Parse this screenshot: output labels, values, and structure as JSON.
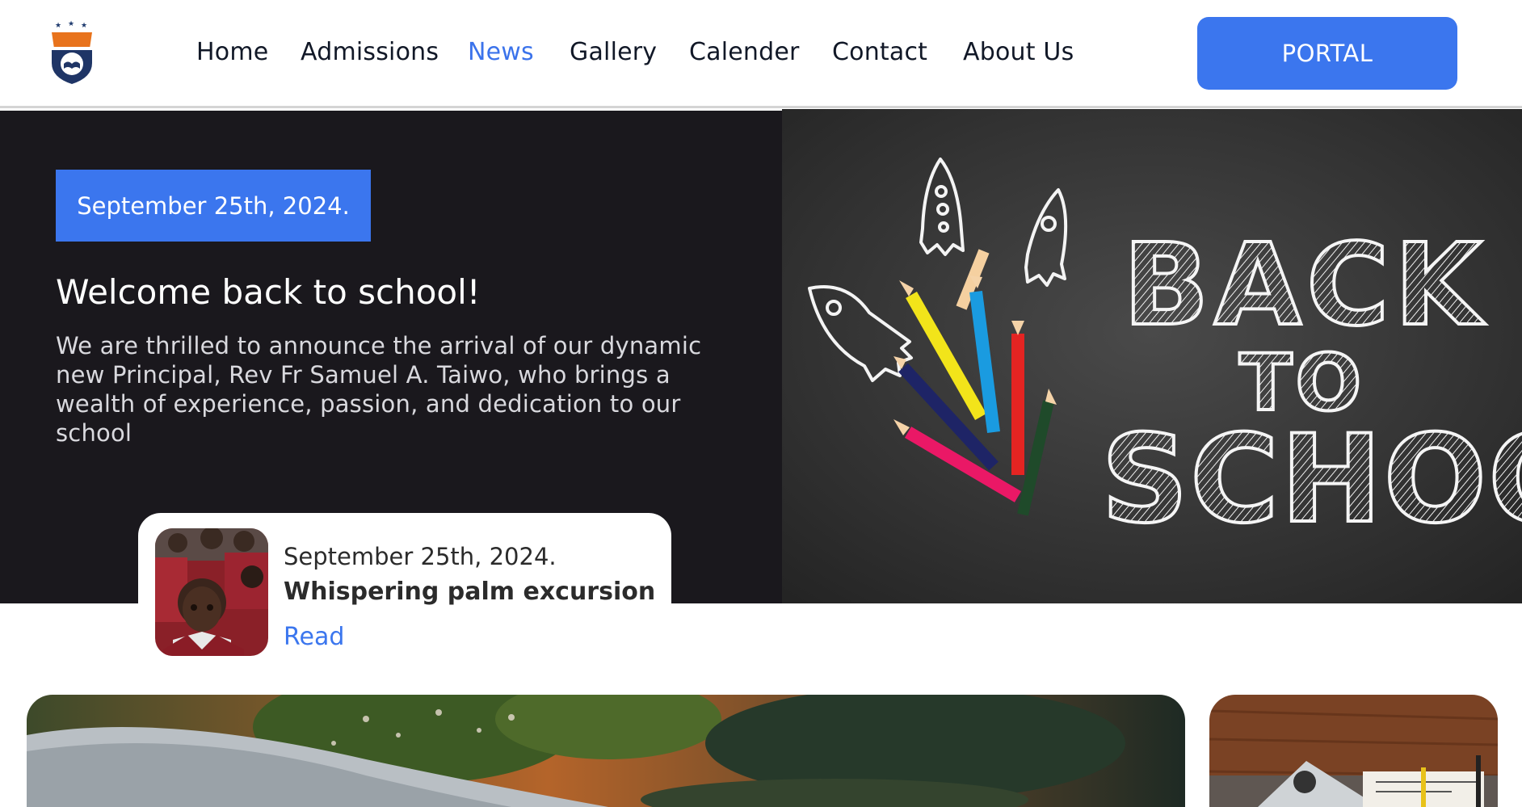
{
  "header": {
    "logo_icon": "school-crest-icon",
    "nav": [
      {
        "label": "Home",
        "active": false
      },
      {
        "label": "Admissions",
        "active": false
      },
      {
        "label": "News",
        "active": true
      },
      {
        "label": "Gallery",
        "active": false
      },
      {
        "label": "Calender",
        "active": false
      },
      {
        "label": "Contact",
        "active": false
      },
      {
        "label": "About Us",
        "active": false
      }
    ],
    "portal_label": "PORTAL"
  },
  "hero": {
    "date": "September 25th, 2024.",
    "title": "Welcome back to school!",
    "text": "We are thrilled to announce the arrival of our dynamic new Principal, Rev Fr Samuel A. Taiwo, who brings a wealth of experience, passion, and dedication to our school",
    "image_text": [
      "BACK",
      "TO",
      "SCHOOL"
    ]
  },
  "news_card": {
    "date": "September 25th, 2024.",
    "title": "Whispering palm excursion",
    "read_label": "Read"
  },
  "colors": {
    "accent": "#3b76ee",
    "hero_bg": "#1a181d"
  }
}
